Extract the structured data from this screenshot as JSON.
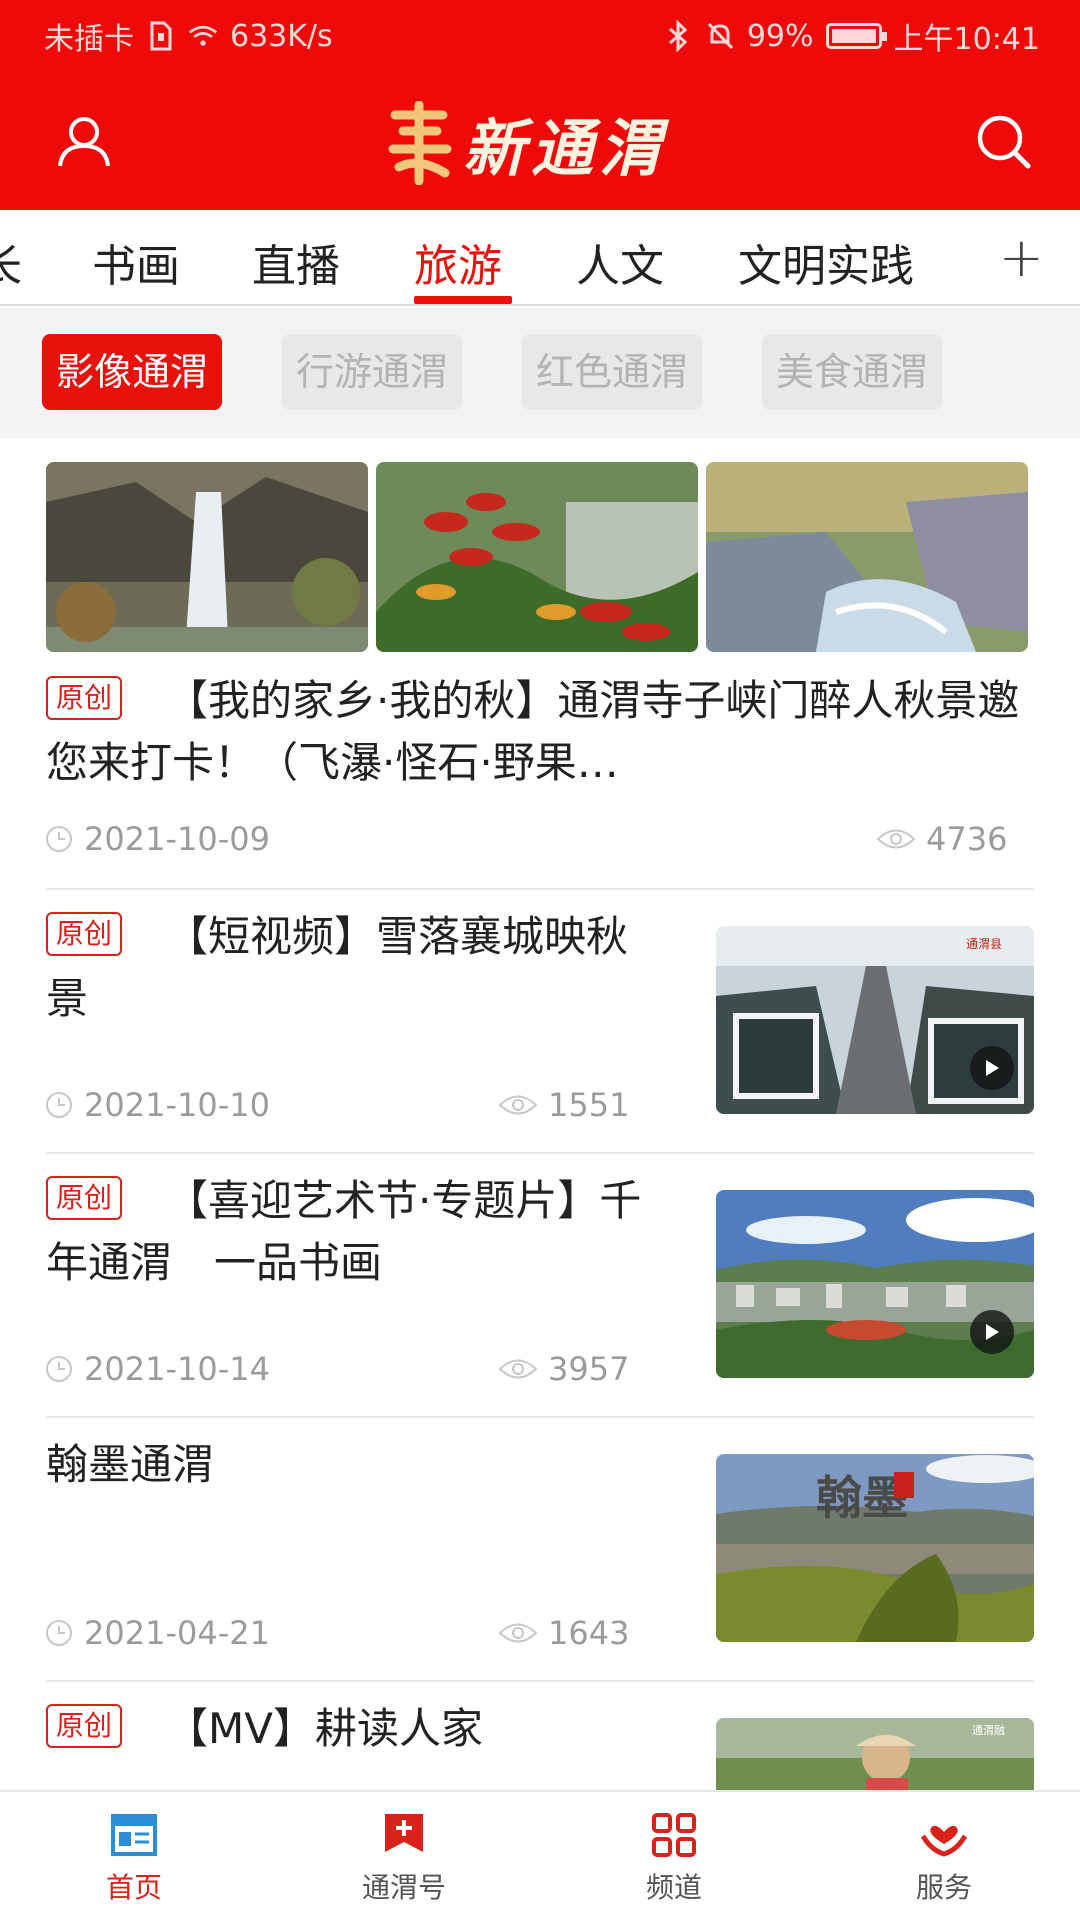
{
  "status_bar": {
    "carrier": "未插卡",
    "speed": "633K/s",
    "battery": "99%",
    "time": "上午10:41"
  },
  "header": {
    "app_title": "新通渭",
    "bg_color": "#ef0a0a"
  },
  "channels": {
    "items": [
      "长",
      "书画",
      "直播",
      "旅游",
      "人文",
      "文明实践"
    ],
    "active": "旅游",
    "more_label": "+"
  },
  "subtabs": {
    "items": [
      "影像通渭",
      "行游通渭",
      "红色通渭",
      "美食通渭"
    ],
    "active": "影像通渭"
  },
  "feed": [
    {
      "tag": "原创",
      "title": "【我的家乡·我的秋】通渭寺子峡门醉人秋景邀您来打卡！（飞瀑·怪石·野果…",
      "date": "2021-10-09",
      "views": "4736"
    },
    {
      "tag": "原创",
      "title": "【短视频】雪落襄城映秋景",
      "date": "2021-10-10",
      "views": "1551",
      "watermark": "通渭县"
    },
    {
      "tag": "原创",
      "title": "【喜迎艺术节·专题片】千年通渭　一品书画",
      "date": "2021-10-14",
      "views": "3957"
    },
    {
      "tag": "",
      "title": "翰墨通渭",
      "date": "2021-04-21",
      "views": "1643",
      "image_text": "翰墨"
    },
    {
      "tag": "原创",
      "title": "【MV】耕读人家",
      "watermark": "通渭融"
    }
  ],
  "bottom_nav": [
    {
      "label": "首页",
      "icon": "news-icon",
      "active": true
    },
    {
      "label": "通渭号",
      "icon": "bookmark-plus-icon",
      "active": false
    },
    {
      "label": "频道",
      "icon": "grid-icon",
      "active": false
    },
    {
      "label": "服务",
      "icon": "hands-heart-icon",
      "active": false
    }
  ],
  "colors": {
    "accent": "#e8120c",
    "text": "#222222",
    "meta": "#9b9b9b"
  }
}
